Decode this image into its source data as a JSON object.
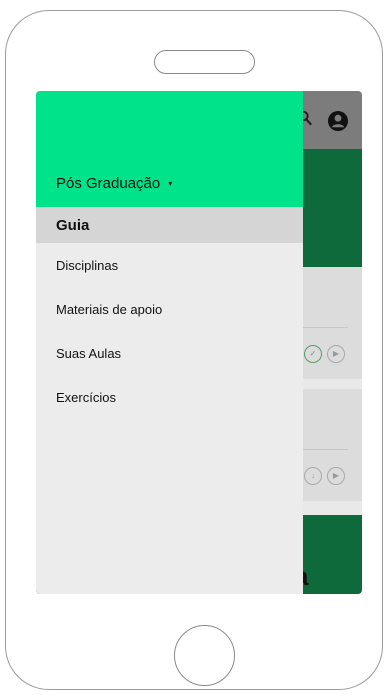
{
  "drawer": {
    "title": "Pós Graduação",
    "title_caret": "▾",
    "items": [
      {
        "label": "Guia",
        "active": true
      },
      {
        "label": "Disciplinas",
        "active": false
      },
      {
        "label": "Materiais de apoio",
        "active": false
      },
      {
        "label": "Suas Aulas",
        "active": false
      },
      {
        "label": "Exercícios",
        "active": false
      }
    ]
  },
  "background_app": {
    "bottom_text": "a",
    "icons": [
      "search-icon",
      "account-icon",
      "check-circle-icon",
      "play-icon",
      "download-icon"
    ]
  },
  "colors": {
    "drawer_header": "#00e38b",
    "app_green": "#0f6a3b",
    "app_topbar": "#7c7c7c"
  }
}
